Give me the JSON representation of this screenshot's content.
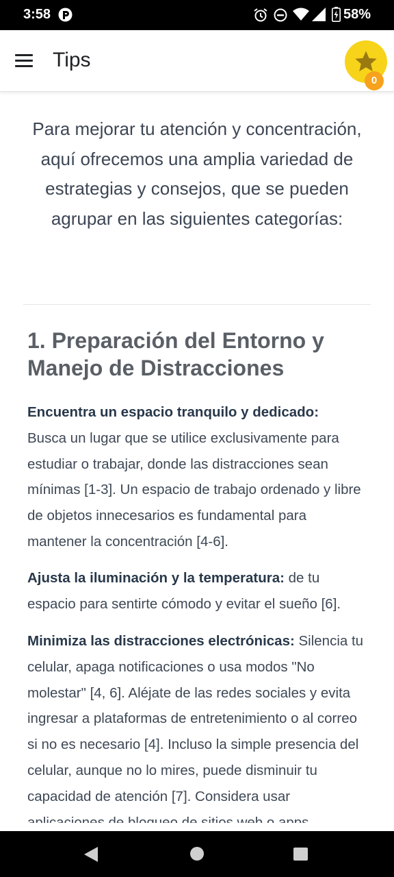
{
  "status_bar": {
    "time": "3:58",
    "battery": "58%",
    "icons": [
      "app-notification-icon",
      "alarm-icon",
      "do-not-disturb-icon",
      "wifi-icon",
      "signal-icon",
      "battery-icon"
    ]
  },
  "app_bar": {
    "title": "Tips",
    "badge_count": "0",
    "star_color": "#f7d31a",
    "badge_color": "#f6a21c"
  },
  "content": {
    "intro": "Para mejorar tu atención y concentración, aquí ofrecemos una amplia variedad de estrategias y consejos, que se pueden agrupar en las siguientes categorías:",
    "section_heading": "1. Preparación del Entorno y Manejo de Distracciones",
    "paragraphs": [
      {
        "bold": "Encuentra un espacio tranquilo y dedicado:",
        "text": "Busca un lugar que se utilice exclusivamente para estudiar o trabajar, donde las distracciones sean mínimas [1-3]. Un espacio de trabajo ordenado y libre de objetos innecesarios es fundamental para mantener la concentración [4-6]."
      },
      {
        "bold": "Ajusta la iluminación y la temperatura:",
        "text": " de tu espacio para sentirte cómodo y evitar el sueño [6]."
      },
      {
        "bold": "Minimiza las distracciones electrónicas:",
        "text": " Silencia tu celular, apaga notificaciones o usa modos \"No molestar\" [4, 6]. Aléjate de las redes sociales y evita ingresar a plataformas de entretenimiento o al correo si no es necesario [4]. Incluso la simple presencia del celular, aunque no lo mires, puede disminuir tu capacidad de atención [7]. Considera usar aplicaciones de bloqueo de sitios web o apps"
      }
    ]
  }
}
